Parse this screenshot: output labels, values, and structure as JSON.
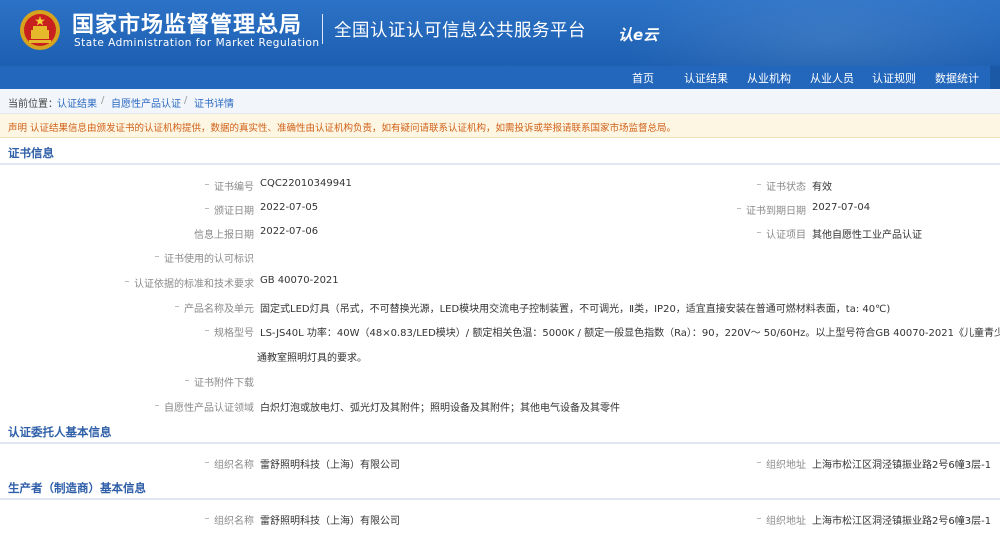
{
  "header": {
    "org_title": "国家市场监督管理总局",
    "org_subtitle": "State Administration  for  Market Regulation",
    "platform_title": "全国认证认可信息公共服务平台",
    "logo_text": "认e云",
    "emblem_icon": "national-emblem-icon",
    "bg_color": "#2367bd"
  },
  "nav": {
    "items": [
      "首页",
      "认证结果",
      "从业机构",
      "从业人员",
      "认证规则",
      "数据统计"
    ]
  },
  "breadcrumb": {
    "current_label": "当前位置：",
    "items": [
      "认证结果",
      "自愿性产品认证",
      "证书详情"
    ],
    "separator": "/"
  },
  "notice": {
    "text": "声明  认证结果信息由颁发证书的认证机构提供，数据的真实性、准确性由认证机构负责，如有疑问请联系认证机构，如需投诉或举报请联系国家市场监督总局。",
    "color": "#d06018"
  },
  "cert_info": {
    "title": "证书信息",
    "cert_no_label": "证书编号",
    "cert_no": "CQC22010349941",
    "status_label": "证书状态",
    "status": "有效",
    "issue_date_label": "颁证日期",
    "issue_date": "2022-07-05",
    "expiry_label": "证书到期日期",
    "expiry_date": "2027-07-04",
    "report_date_label": "信息上报日期",
    "report_date": "2022-07-06",
    "project_label": "认证项目",
    "project": "其他自愿性工业产品认证",
    "mark_label": "证书使用的认可标识",
    "mark": "",
    "standard_label": "认证依据的标准和技术要求",
    "standard": "GB 40070-2021",
    "product_label": "产品名称及单元",
    "product": "固定式LED灯具（吊式，不可替换光源，LED模块用交流电子控制装置，不可调光，Ⅱ类，IP20，适宜直接安装在普通可燃材料表面，ta: 40℃)",
    "model_label": "规格型号",
    "model_line1": "LS-JS40L 功率：40W（48×0.83/LED模块）/ 额定相关色温：5000K / 额定一般显色指数（Ra）：90，220V～ 50/60Hz。以上型号符合GB 40070-2021《儿童青少年学习用",
    "model_line2": "通教室照明灯具的要求。",
    "attachment_label": "证书附件下载",
    "attachment": "",
    "field_label": "自愿性产品认证领域",
    "field": "白炽灯泡或放电灯、弧光灯及其附件；照明设备及其附件；其他电气设备及其零件"
  },
  "client_info": {
    "title": "认证委托人基本信息",
    "org_name_label": "组织名称",
    "org_name": "雷舒照明科技（上海）有限公司",
    "org_addr_label": "组织地址",
    "org_addr": "上海市松江区洞泾镇振业路2号6幢3层-1"
  },
  "producer_info": {
    "title": "生产者（制造商）基本信息",
    "org_name_label": "组织名称",
    "org_name": "雷舒照明科技（上海）有限公司",
    "org_addr_label": "组织地址",
    "org_addr": "上海市松江区洞泾镇振业路2号6幢3层-1"
  }
}
